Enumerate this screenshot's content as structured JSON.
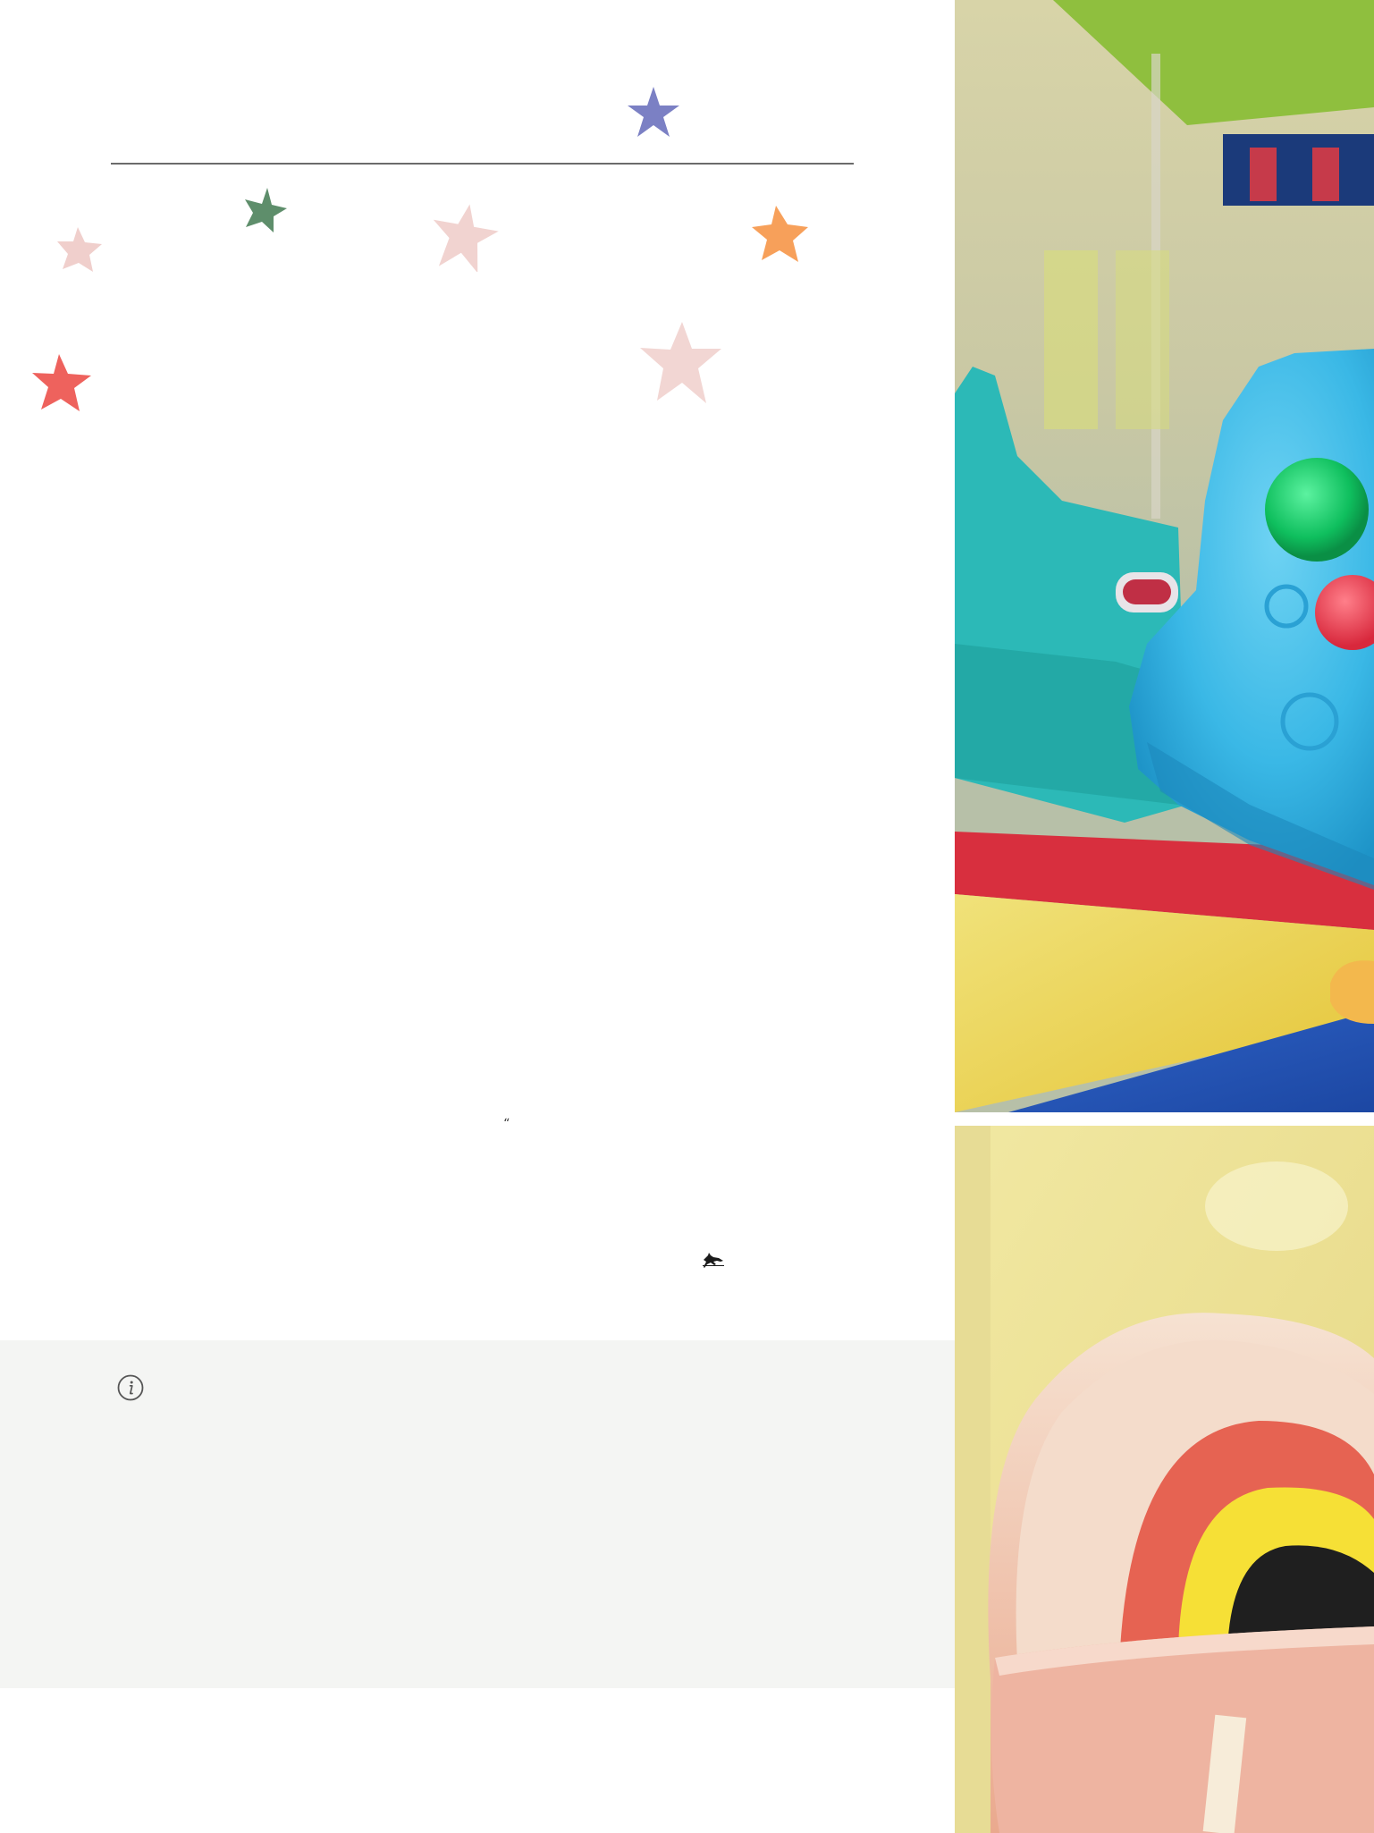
{
  "decor": {
    "stars": [
      {
        "name": "star-blue",
        "color": "#7b80c4"
      },
      {
        "name": "star-green",
        "color": "#5e8e6b"
      },
      {
        "name": "star-pink-small",
        "color": "#f0cfcc"
      },
      {
        "name": "star-pink-mid",
        "color": "#f1d3d0"
      },
      {
        "name": "star-orange",
        "color": "#f7a05a"
      },
      {
        "name": "star-red",
        "color": "#ee625d"
      },
      {
        "name": "star-pink-large",
        "color": "#f2d6d3"
      }
    ],
    "rule_color": "#6b6b6b"
  },
  "quote": {
    "mark": "“"
  },
  "info_panel": {
    "icon": "info-icon",
    "background": "#f4f5f3"
  },
  "photos": {
    "top": {
      "icon": "playground-rocker-photo"
    },
    "bottom": {
      "icon": "rainbow-beanbag-photo"
    }
  },
  "logo": {
    "icon": "horse-icon"
  }
}
